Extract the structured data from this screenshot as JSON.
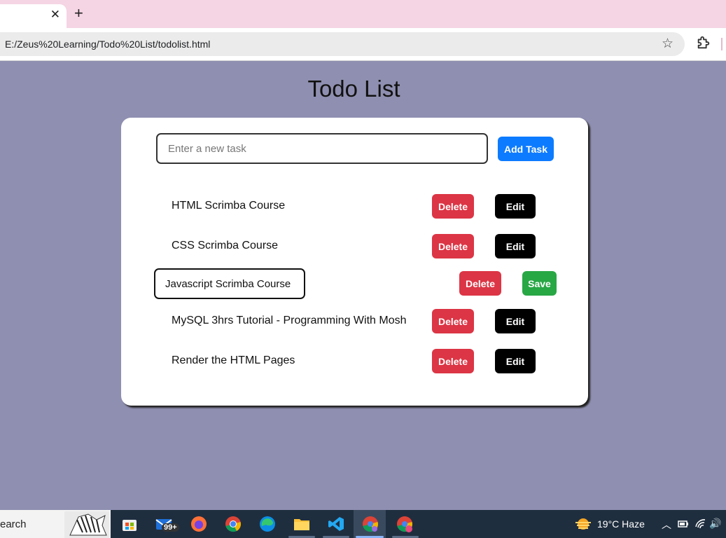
{
  "browser": {
    "tab_close": "✕",
    "new_tab": "+",
    "url": "E:/Zeus%20Learning/Todo%20List/todolist.html",
    "bookmark_icon": "star-icon",
    "extensions_icon": "puzzle-icon"
  },
  "page": {
    "title": "Todo List",
    "input_placeholder": "Enter a new task",
    "add_label": "Add Task"
  },
  "tasks": [
    {
      "text": "HTML Scrimba Course",
      "delete_label": "Delete",
      "action_label": "Edit",
      "editing": false
    },
    {
      "text": "CSS Scrimba Course",
      "delete_label": "Delete",
      "action_label": "Edit",
      "editing": false
    },
    {
      "text": "Javascript Scrimba Course",
      "delete_label": "Delete",
      "action_label": "Save",
      "editing": true
    },
    {
      "text": "MySQL 3hrs Tutorial - Programming With Mosh",
      "delete_label": "Delete",
      "action_label": "Edit",
      "editing": false
    },
    {
      "text": "Render the HTML Pages",
      "delete_label": "Delete",
      "action_label": "Edit",
      "editing": false
    }
  ],
  "taskbar": {
    "search_text": "earch",
    "mail_badge": "99+",
    "weather": "19°C  Haze",
    "tray_chevron": "^",
    "volume_icon": "🔊"
  },
  "colors": {
    "page_bg": "#8f8fb1",
    "primary": "#0d7bff",
    "danger": "#dc3545",
    "success": "#28a745",
    "edit": "#000000"
  }
}
